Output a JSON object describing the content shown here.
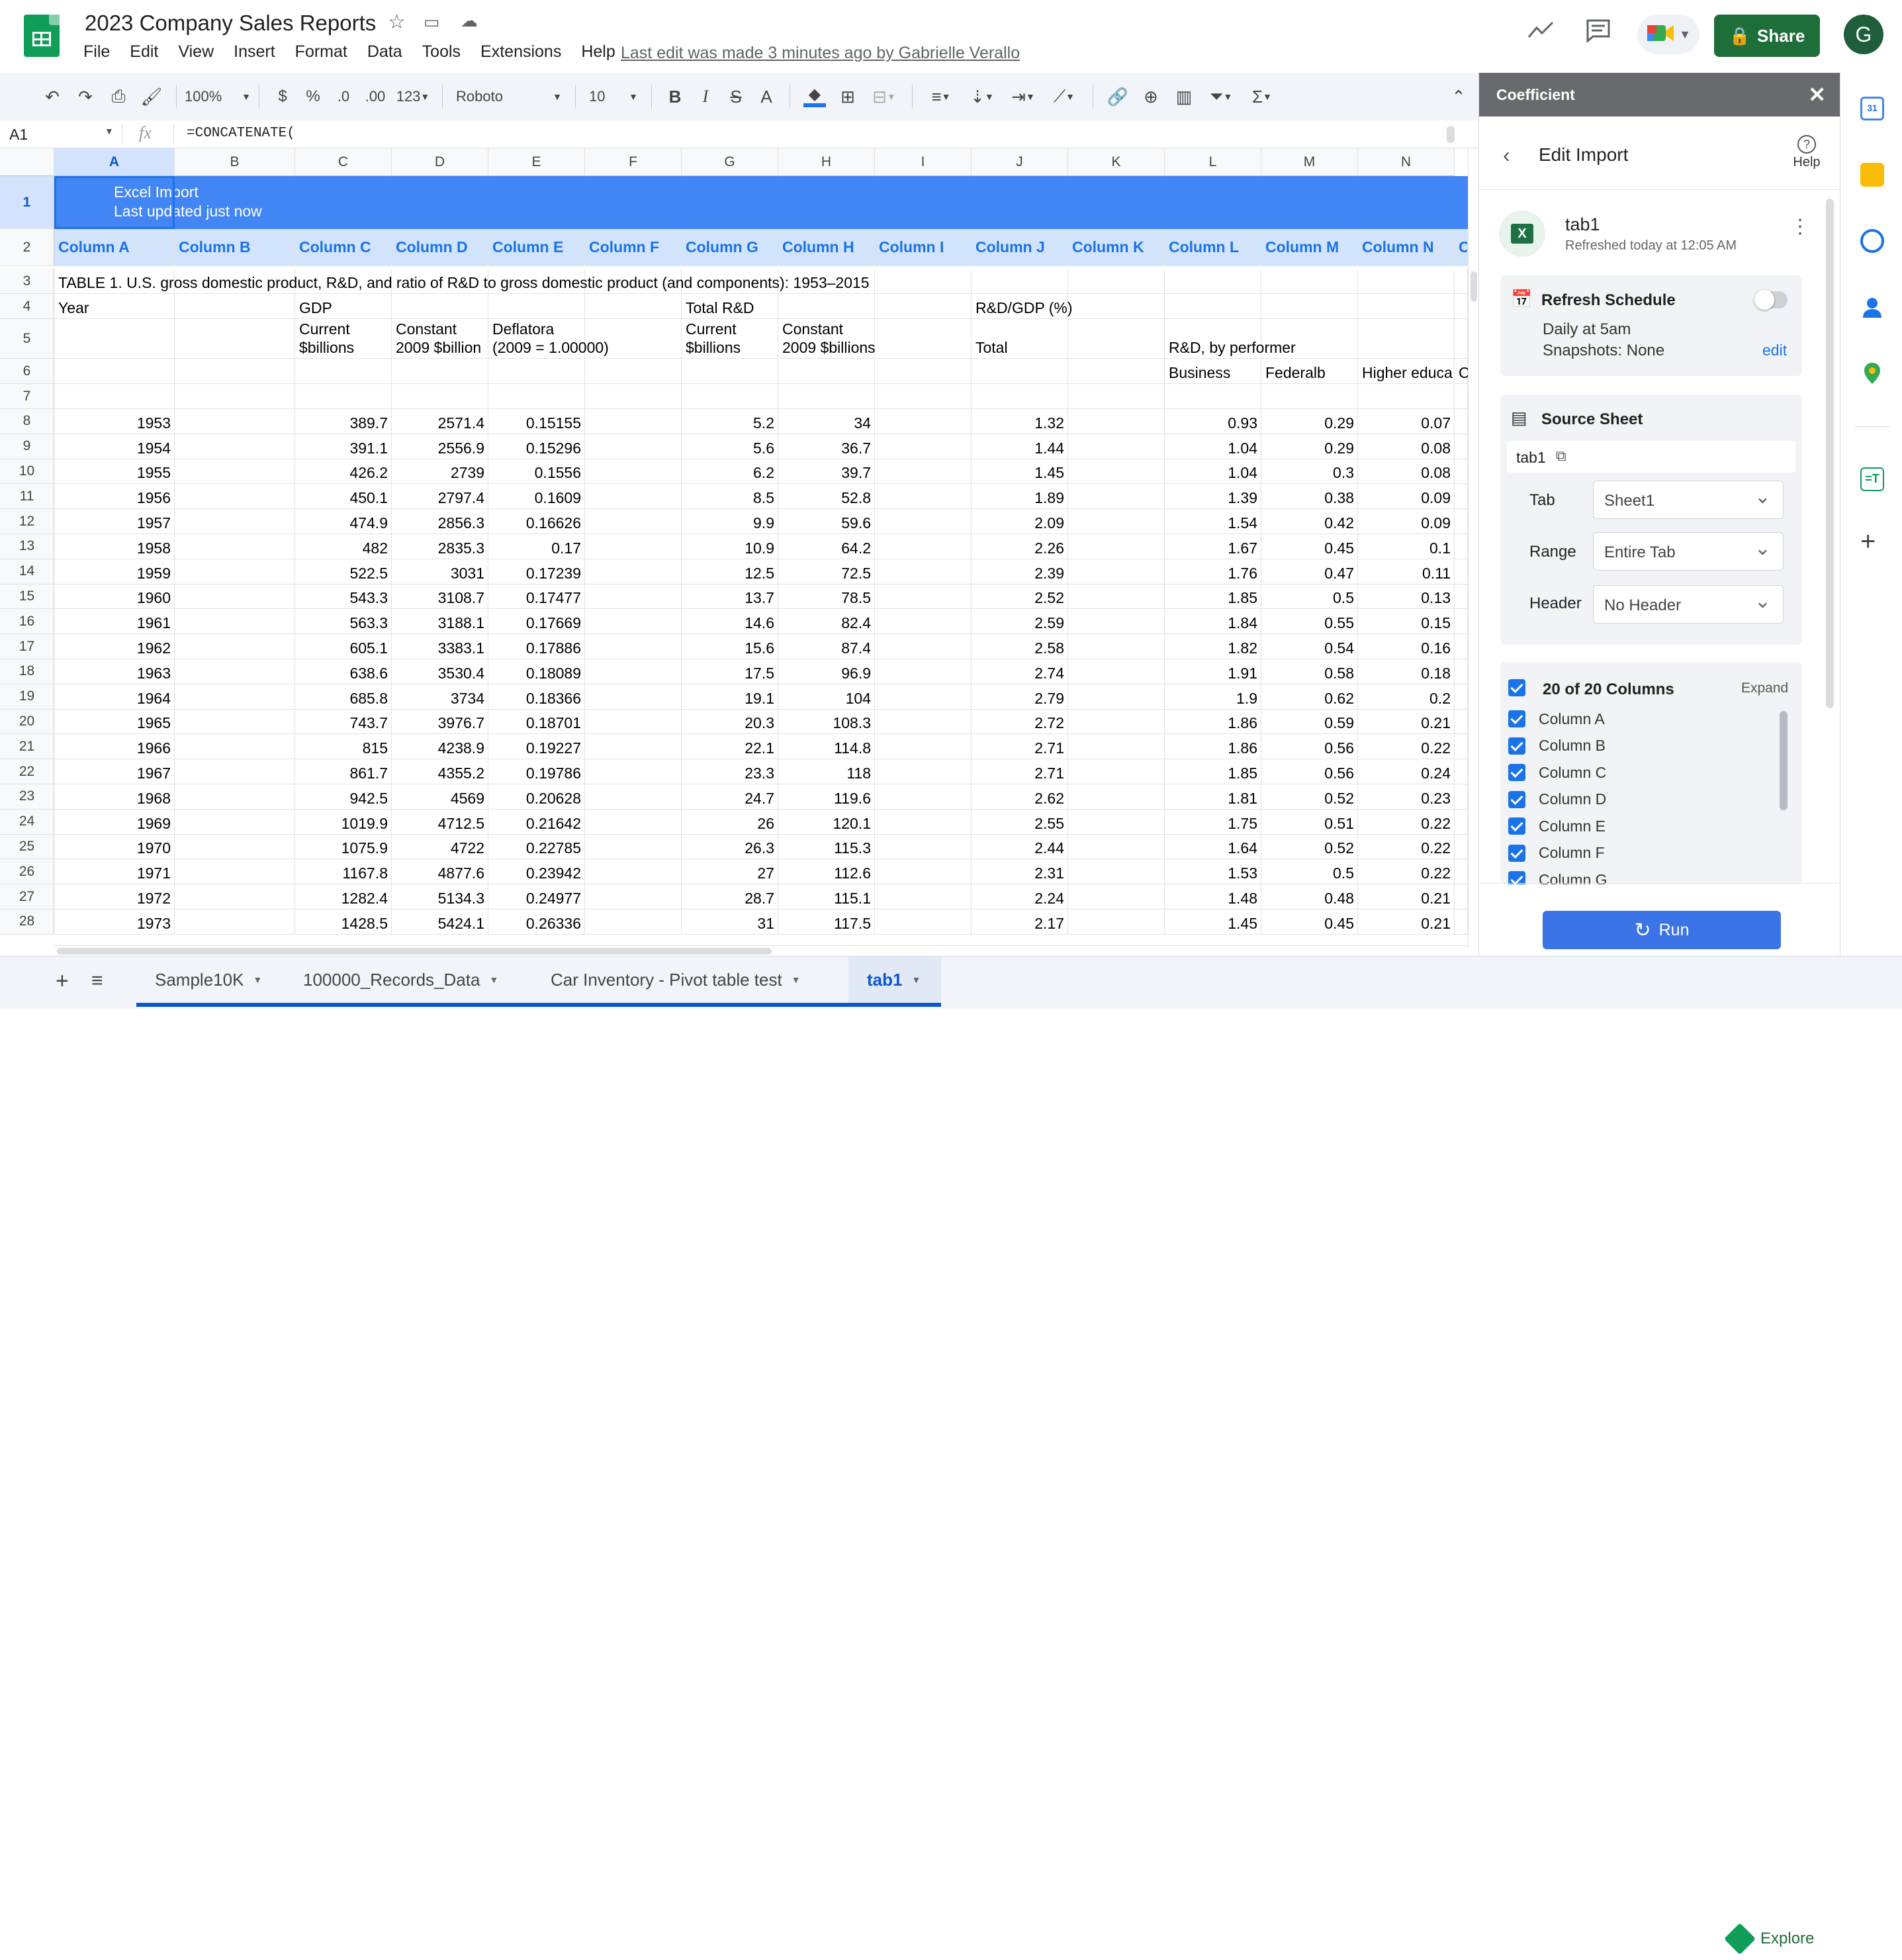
{
  "app": {
    "doc_title": "2023 Company Sales Reports",
    "menu": [
      "File",
      "Edit",
      "View",
      "Insert",
      "Format",
      "Data",
      "Tools",
      "Extensions",
      "Help"
    ],
    "last_edit": "Last edit was made 3 minutes ago by Gabrielle Verallo",
    "share_label": "Share",
    "avatar_letter": "G"
  },
  "toolbar": {
    "zoom": "100%",
    "currency": "$",
    "percent": "%",
    "dec_less": ".0",
    "dec_more": ".00",
    "format_more": "123",
    "font": "Roboto",
    "font_size": "10"
  },
  "formula_bar": {
    "name_box": "A1",
    "fx": "fx",
    "formula": "=CONCATENATE("
  },
  "grid": {
    "columns": [
      "A",
      "B",
      "C",
      "D",
      "E",
      "F",
      "G",
      "H",
      "I",
      "J",
      "K",
      "L",
      "M",
      "N"
    ],
    "banner_line1": "Excel Import",
    "banner_line2": "Last updated just now",
    "header_row": [
      "Column A",
      "Column B",
      "Column C",
      "Column D",
      "Column E",
      "Column F",
      "Column G",
      "Column H",
      "Column I",
      "Column J",
      "Column K",
      "Column L",
      "Column M",
      "Column N",
      "C"
    ],
    "row3": "TABLE 1. U.S. gross domestic product, R&D, and ratio of R&D to gross domestic product (and components): 1953–2015",
    "row4": {
      "a": "Year",
      "c": "GDP",
      "g": "Total R&D",
      "j": "R&D/GDP (%)"
    },
    "row5": {
      "c1": "Current",
      "c2": "$billions",
      "d1": "Constant",
      "d2": " 2009 $billion",
      "e1": "Deflatora",
      "e2": " (2009 = 1.00000)",
      "g1": "Current",
      "g2": "$billions",
      "h1": "Constant",
      "h2": " 2009 $billions",
      "j": "Total",
      "l": "R&D, by performer"
    },
    "row6": {
      "l": "Business",
      "m": "Federalb",
      "n": "Higher educa",
      "o": "C"
    },
    "data_rows": [
      [
        "1953",
        "389.7",
        "2571.4",
        "0.15155",
        "5.2",
        "34",
        "1.32",
        "0.93",
        "0.29",
        "0.07"
      ],
      [
        "1954",
        "391.1",
        "2556.9",
        "0.15296",
        "5.6",
        "36.7",
        "1.44",
        "1.04",
        "0.29",
        "0.08"
      ],
      [
        "1955",
        "426.2",
        "2739",
        "0.1556",
        "6.2",
        "39.7",
        "1.45",
        "1.04",
        "0.3",
        "0.08"
      ],
      [
        "1956",
        "450.1",
        "2797.4",
        "0.1609",
        "8.5",
        "52.8",
        "1.89",
        "1.39",
        "0.38",
        "0.09"
      ],
      [
        "1957",
        "474.9",
        "2856.3",
        "0.16626",
        "9.9",
        "59.6",
        "2.09",
        "1.54",
        "0.42",
        "0.09"
      ],
      [
        "1958",
        "482",
        "2835.3",
        "0.17",
        "10.9",
        "64.2",
        "2.26",
        "1.67",
        "0.45",
        "0.1"
      ],
      [
        "1959",
        "522.5",
        "3031",
        "0.17239",
        "12.5",
        "72.5",
        "2.39",
        "1.76",
        "0.47",
        "0.11"
      ],
      [
        "1960",
        "543.3",
        "3108.7",
        "0.17477",
        "13.7",
        "78.5",
        "2.52",
        "1.85",
        "0.5",
        "0.13"
      ],
      [
        "1961",
        "563.3",
        "3188.1",
        "0.17669",
        "14.6",
        "82.4",
        "2.59",
        "1.84",
        "0.55",
        "0.15"
      ],
      [
        "1962",
        "605.1",
        "3383.1",
        "0.17886",
        "15.6",
        "87.4",
        "2.58",
        "1.82",
        "0.54",
        "0.16"
      ],
      [
        "1963",
        "638.6",
        "3530.4",
        "0.18089",
        "17.5",
        "96.9",
        "2.74",
        "1.91",
        "0.58",
        "0.18"
      ],
      [
        "1964",
        "685.8",
        "3734",
        "0.18366",
        "19.1",
        "104",
        "2.79",
        "1.9",
        "0.62",
        "0.2"
      ],
      [
        "1965",
        "743.7",
        "3976.7",
        "0.18701",
        "20.3",
        "108.3",
        "2.72",
        "1.86",
        "0.59",
        "0.21"
      ],
      [
        "1966",
        "815",
        "4238.9",
        "0.19227",
        "22.1",
        "114.8",
        "2.71",
        "1.86",
        "0.56",
        "0.22"
      ],
      [
        "1967",
        "861.7",
        "4355.2",
        "0.19786",
        "23.3",
        "118",
        "2.71",
        "1.85",
        "0.56",
        "0.24"
      ],
      [
        "1968",
        "942.5",
        "4569",
        "0.20628",
        "24.7",
        "119.6",
        "2.62",
        "1.81",
        "0.52",
        "0.23"
      ],
      [
        "1969",
        "1019.9",
        "4712.5",
        "0.21642",
        "26",
        "120.1",
        "2.55",
        "1.75",
        "0.51",
        "0.22"
      ],
      [
        "1970",
        "1075.9",
        "4722",
        "0.22785",
        "26.3",
        "115.3",
        "2.44",
        "1.64",
        "0.52",
        "0.22"
      ],
      [
        "1971",
        "1167.8",
        "4877.6",
        "0.23942",
        "27",
        "112.6",
        "2.31",
        "1.53",
        "0.5",
        "0.22"
      ],
      [
        "1972",
        "1282.4",
        "5134.3",
        "0.24977",
        "28.7",
        "115.1",
        "2.24",
        "1.48",
        "0.48",
        "0.21"
      ],
      [
        "1973",
        "1428.5",
        "5424.1",
        "0.26336",
        "31",
        "117.5",
        "2.17",
        "1.45",
        "0.45",
        "0.21"
      ]
    ]
  },
  "panel": {
    "title": "Coefficient",
    "edit_import": "Edit Import",
    "help": "Help",
    "source_name": "tab1",
    "refreshed": "Refreshed today at 12:05 AM",
    "refresh_schedule": "Refresh Schedule",
    "schedule_line1": "Daily at 5am",
    "schedule_line2": "Snapshots: None",
    "edit_link": "edit",
    "source_sheet": "Source Sheet",
    "sheet_link": "tab1",
    "tab_label": "Tab",
    "tab_value": "Sheet1",
    "range_label": "Range",
    "range_value": "Entire Tab",
    "header_label": "Header",
    "header_value": "No Header",
    "columns_count": "20 of 20 Columns",
    "expand": "Expand",
    "columns": [
      "Column A",
      "Column B",
      "Column C",
      "Column D",
      "Column E",
      "Column F",
      "Column G"
    ],
    "run": "Run"
  },
  "sheet_tabs": [
    "Sample10K",
    "100000_Records_Data",
    "Car Inventory - Pivot table test",
    "tab1"
  ],
  "active_tab": "tab1",
  "explore": "Explore",
  "colors": {
    "accent": "#1a73e8",
    "banner": "#4285f4",
    "header_row": "#d2e3fc",
    "share": "#1e6e3a"
  }
}
